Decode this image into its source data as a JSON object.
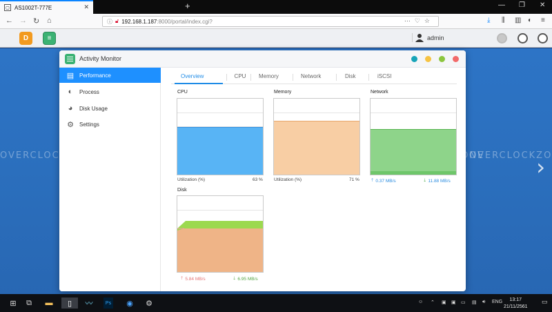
{
  "browser": {
    "tab_title": "AS1002T-777E",
    "url_host": "192.168.1.187",
    "url_path": ":8000/portal/index.cgi?"
  },
  "nas": {
    "username": "admin"
  },
  "watermark": "OVERCLOCKZONE",
  "window": {
    "title": "Activity Monitor"
  },
  "sidebar": {
    "items": [
      {
        "label": "Performance",
        "icon": "performance-icon",
        "active": true
      },
      {
        "label": "Process",
        "icon": "process-icon"
      },
      {
        "label": "Disk Usage",
        "icon": "disk-usage-icon"
      },
      {
        "label": "Settings",
        "icon": "gear-icon"
      }
    ]
  },
  "tabs": [
    "Overview",
    "CPU",
    "Memory",
    "Network",
    "Disk",
    "iSCSI"
  ],
  "panels": {
    "cpu": {
      "title": "CPU",
      "label": "Utilization (%)",
      "value": "63 %",
      "fill": 0.63,
      "color": "#58b4f5"
    },
    "memory": {
      "title": "Memory",
      "label": "Utilization (%)",
      "value": "71 %",
      "fill": 0.71,
      "color": "#f8cea4"
    },
    "network": {
      "title": "Network",
      "up": "0.37 MB/s",
      "down": "11.88 MB/s",
      "color": "#8ed48a"
    },
    "disk": {
      "title": "Disk",
      "read": "5.84 MB/s",
      "write": "6.95 MB/s",
      "color": "#efb487",
      "accent": "#9cd94f"
    }
  },
  "taskbar": {
    "lang": "ENG",
    "time": "13:17",
    "date": "21/11/2561"
  }
}
